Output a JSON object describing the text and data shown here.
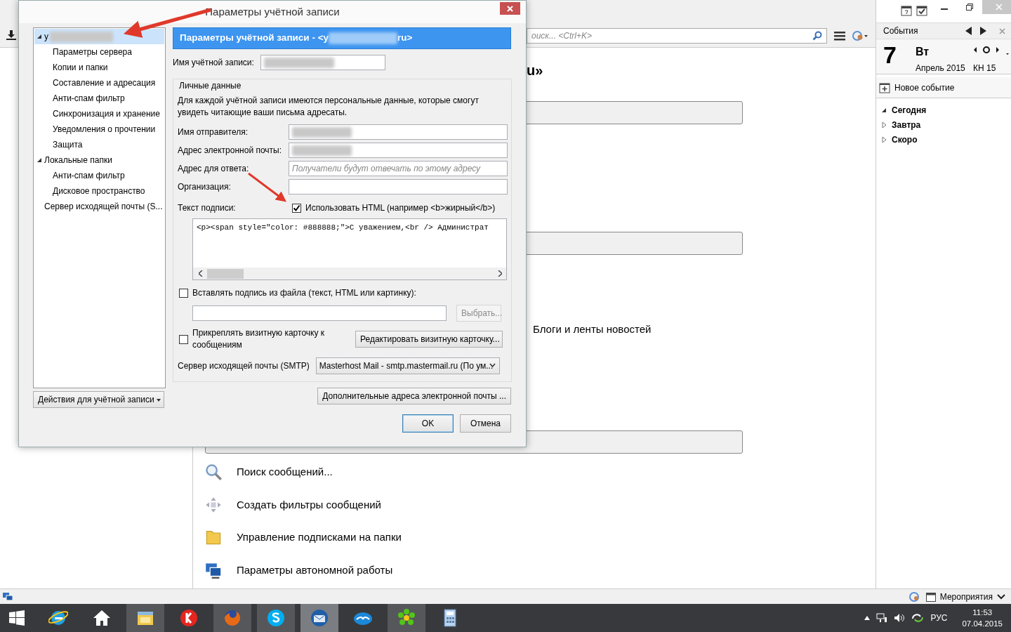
{
  "dialog": {
    "title": "Параметры учётной записи",
    "tree": [
      {
        "label": "у",
        "selected": true,
        "expanded": true,
        "redacted": true,
        "children": [
          {
            "label": "Параметры сервера",
            "selected": false
          },
          {
            "label": "Копии и папки",
            "selected": false
          },
          {
            "label": "Составление и адресация",
            "selected": false
          },
          {
            "label": "Анти-спам фильтр",
            "selected": false
          },
          {
            "label": "Синхронизация и хранение",
            "selected": false
          },
          {
            "label": "Уведомления о прочтении",
            "selected": false
          },
          {
            "label": "Защита",
            "selected": false
          }
        ]
      },
      {
        "label": "Локальные папки",
        "selected": false,
        "expanded": true,
        "children": [
          {
            "label": "Анти-спам фильтр",
            "selected": false
          },
          {
            "label": "Дисковое пространство",
            "selected": false
          }
        ]
      },
      {
        "label": "Сервер исходящей почты (S...",
        "selected": false
      }
    ],
    "account_actions_button": "Действия для учётной записи",
    "header": {
      "prefix": "Параметры учётной записи - <у",
      "suffix": "ru>"
    },
    "account_name": {
      "label": "Имя учётной записи:",
      "redacted": true
    },
    "identity": {
      "legend": "Личные данные",
      "description": "Для каждой учётной записи имеются персональные данные, которые смогут увидеть читающие ваши письма адресаты.",
      "fields": [
        {
          "label": "Имя отправителя:",
          "redacted": true
        },
        {
          "label": "Адрес электронной почты:",
          "redacted": true
        },
        {
          "label": "Адрес для ответа:",
          "placeholder": "Получатели будут отвечать по этому адресу"
        },
        {
          "label": "Организация:"
        }
      ],
      "signature_label": "Текст подписи:",
      "use_html": {
        "label": "Использовать HTML (например <b>жирный</b>)",
        "checked": true
      },
      "signature_text": "<p><span style=\"color: #888888;\">С уважением,<br /> Администрат",
      "file_signature": {
        "label": "Вставлять подпись из файла (текст, HTML или картинку):",
        "checked": false
      },
      "choose_button": {
        "label": "Выбрать...",
        "disabled": true
      },
      "attach_vcard": {
        "label": "Прикреплять визитную карточку к сообщениям",
        "checked": false
      },
      "edit_vcard_button": "Редактировать визитную карточку...",
      "smtp_label": "Сервер исходящей почты (SMTP)",
      "smtp_value": "Masterhost Mail - smtp.mastermail.ru (По ум..."
    },
    "extra_addresses_button": "Дополнительные адреса электронной почты ...",
    "buttons": [
      {
        "label": "OK",
        "default": true
      },
      {
        "label": "Отмена",
        "default": false
      }
    ]
  },
  "app": {
    "search_placeholder": "оиск... <Ctrl+K>",
    "heading_fragment": "u»",
    "blogs_label": "Блоги и ленты новостей",
    "actions": [
      {
        "kind": "search",
        "label": "Поиск сообщений..."
      },
      {
        "kind": "filter",
        "label": "Создать фильтры сообщений"
      },
      {
        "kind": "folder",
        "label": "Управление подписками на папки"
      },
      {
        "kind": "offline",
        "label": "Параметры автономной работы"
      }
    ]
  },
  "calendar": {
    "title": "События",
    "day": "7",
    "weekday": "Вт",
    "month": "Апрель 2015",
    "week": "КН 15",
    "new_event": "Новое событие",
    "groups": [
      {
        "label": "Сегодня",
        "expanded": true
      },
      {
        "label": "Завтра",
        "expanded": false
      },
      {
        "label": "Скоро",
        "expanded": false
      }
    ]
  },
  "status_bar": {
    "events_label": "Мероприятия"
  },
  "taskbar": {
    "apps": [
      {
        "kind": "browser-e",
        "running": false,
        "active": false
      },
      {
        "kind": "home",
        "running": false,
        "active": false
      },
      {
        "kind": "explorer",
        "running": true,
        "active": false
      },
      {
        "kind": "yandex",
        "running": false,
        "active": false
      },
      {
        "kind": "firefox",
        "running": true,
        "active": false
      },
      {
        "kind": "skype",
        "running": true,
        "active": false
      },
      {
        "kind": "mail",
        "running": true,
        "active": true
      },
      {
        "kind": "cloud",
        "running": false,
        "active": false
      },
      {
        "kind": "flower",
        "running": true,
        "active": false
      },
      {
        "kind": "calculator",
        "running": false,
        "active": false
      }
    ],
    "language": "РУС",
    "time": "11:53",
    "date": "07.04.2015"
  }
}
